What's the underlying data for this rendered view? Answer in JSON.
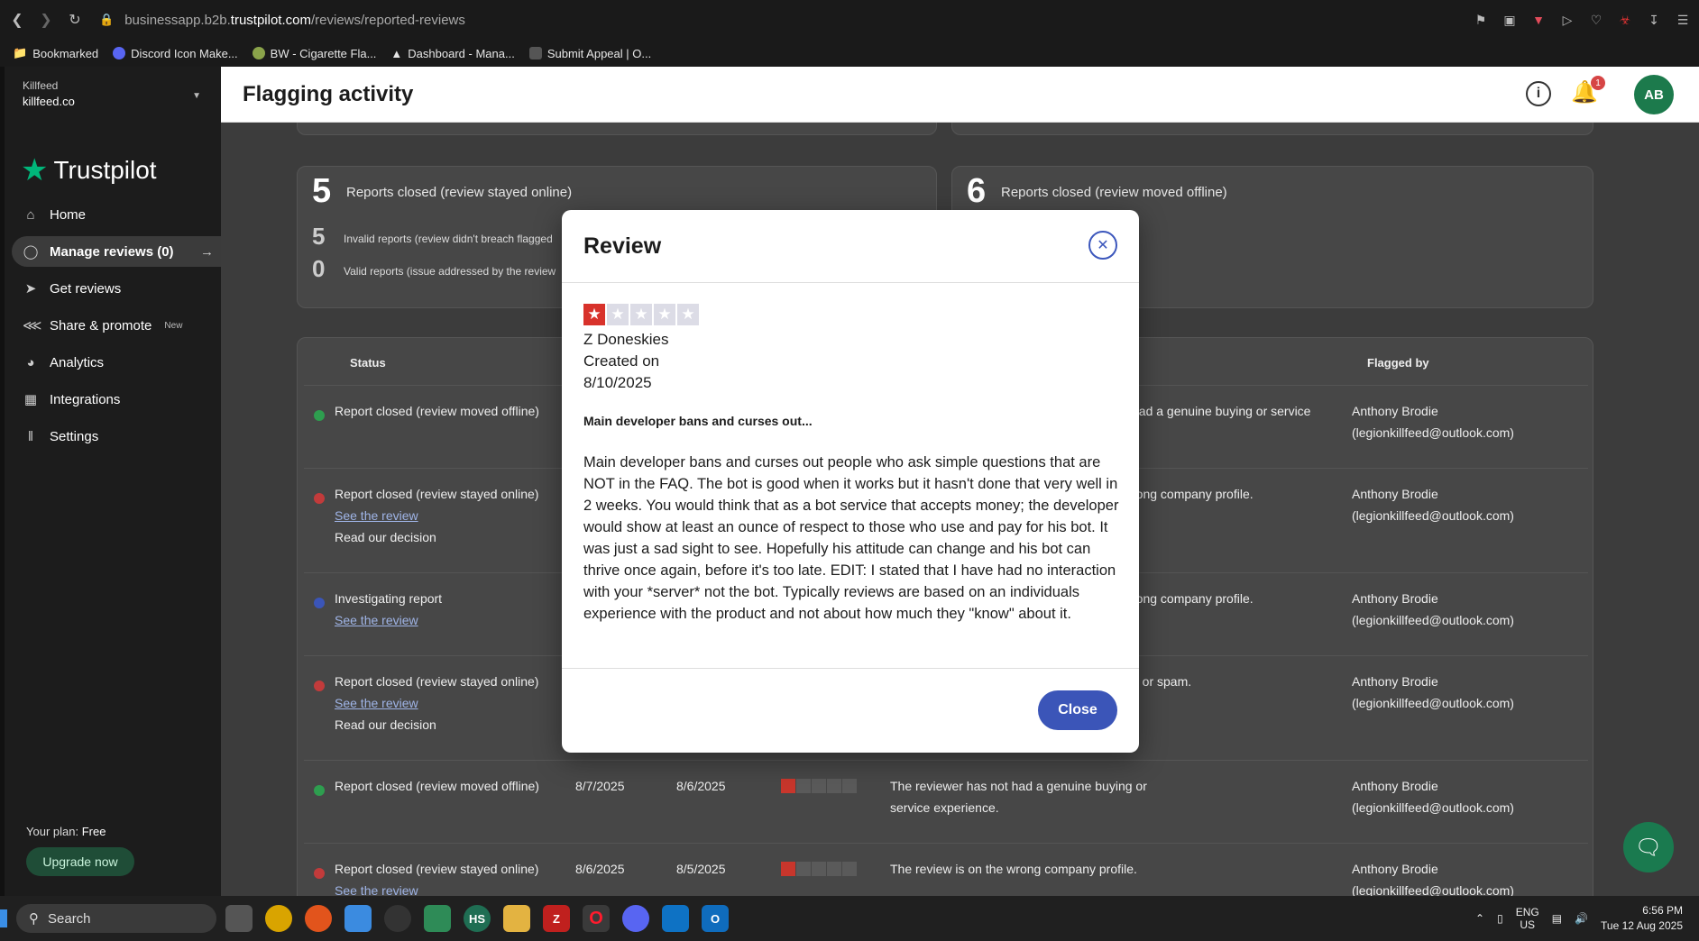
{
  "browser": {
    "url_prefix": "businessapp.b2b.",
    "url_host": "trustpilot.com",
    "url_path": "/reviews/reported-reviews",
    "bookmarks": [
      {
        "label": "Bookmarked"
      },
      {
        "label": "Discord Icon Make..."
      },
      {
        "label": "BW - Cigarette Fla..."
      },
      {
        "label": "Dashboard - Mana..."
      },
      {
        "label": "Submit Appeal | O..."
      }
    ]
  },
  "sidebar": {
    "account_name": "Killfeed",
    "account_domain": "killfeed.co",
    "logo_text": "Trustpilot",
    "items": [
      {
        "label": "Home",
        "icon": "home-icon"
      },
      {
        "label": "Manage reviews (0)",
        "icon": "chat-icon"
      },
      {
        "label": "Get reviews",
        "icon": "send-icon"
      },
      {
        "label": "Share & promote",
        "icon": "share-icon",
        "badge": "New"
      },
      {
        "label": "Analytics",
        "icon": "chart-icon"
      },
      {
        "label": "Integrations",
        "icon": "integrations-icon"
      },
      {
        "label": "Settings",
        "icon": "sliders-icon"
      }
    ],
    "plan_label": "Your plan:",
    "plan_value": "Free",
    "upgrade": "Upgrade now"
  },
  "header": {
    "title": "Flagging activity",
    "notifications": "1",
    "avatar": "AB"
  },
  "stats": {
    "left_big": "5",
    "left_label": "Reports closed (review stayed online)",
    "invalid_num": "5",
    "invalid_label": "Invalid reports (review didn't breach flagged",
    "valid_num": "0",
    "valid_label": "Valid reports (issue addressed by the review",
    "right_big": "6",
    "right_label": "Reports closed (review moved offline)"
  },
  "table": {
    "col_status": "Status",
    "col_flagged_by": "Flagged by",
    "rows": [
      {
        "status": "Report closed (review moved offline)",
        "status_color": "#2e9e4f",
        "links": [],
        "reason": "had a genuine buying or service",
        "flagger": "Anthony Brodie",
        "email": "(legionkillfeed@outlook.com)"
      },
      {
        "status": "Report closed (review stayed online)",
        "status_color": "#c23b3b",
        "links": [
          "See the review",
          "Read our decision"
        ],
        "reason": "rong company profile.",
        "flagger": "Anthony Brodie",
        "email": "(legionkillfeed@outlook.com)"
      },
      {
        "status": "Investigating report",
        "status_color": "#3b55b8",
        "links": [
          "See the review"
        ],
        "reason": "rong company profile.",
        "flagger": "Anthony Brodie",
        "email": "(legionkillfeed@outlook.com)"
      },
      {
        "status": "Report closed (review stayed online)",
        "status_color": "#c23b3b",
        "links": [
          "See the review",
          "Read our decision"
        ],
        "reason": "g or spam.",
        "flagger": "Anthony Brodie",
        "email": "(legionkillfeed@outlook.com)"
      },
      {
        "status": "Report closed (review moved offline)",
        "status_color": "#2e9e4f",
        "links": [],
        "date1": "8/7/2025",
        "date2": "8/6/2025",
        "reason": "The reviewer has not had a genuine buying or service experience.",
        "flagger": "Anthony Brodie",
        "email": "(legionkillfeed@outlook.com)"
      },
      {
        "status": "Report closed (review stayed online)",
        "status_color": "#c23b3b",
        "links": [
          "See the review"
        ],
        "date1": "8/6/2025",
        "date2": "8/5/2025",
        "reason": "The review is on the wrong company profile.",
        "flagger": "Anthony Brodie",
        "email": "(legionkillfeed@outlook.com)"
      }
    ]
  },
  "modal": {
    "title": "Review",
    "rating": 1,
    "reviewer": "Z Doneskies",
    "created_label": "Created on",
    "created_date": "8/10/2025",
    "review_title": "Main developer bans and curses out...",
    "review_body": "Main developer bans and curses out people who ask simple questions that are NOT in the FAQ. The bot is good when it works but it hasn't done that very well in 2 weeks. You would think that as a bot service that accepts money; the developer would show at least an ounce of respect to those who use and pay for his bot. It was just a sad sight to see. Hopefully his attitude can change and his bot can thrive once again, before it's too late. EDIT: I stated that I have had no interaction with your *server* not the bot. Typically reviews are based on an individuals experience with the product and not about how much they \"know\" about it.",
    "close_label": "Close"
  },
  "taskbar": {
    "search": "Search",
    "lang1": "ENG",
    "lang2": "US",
    "time": "6:56 PM",
    "date": "Tue 12 Aug 2025"
  }
}
